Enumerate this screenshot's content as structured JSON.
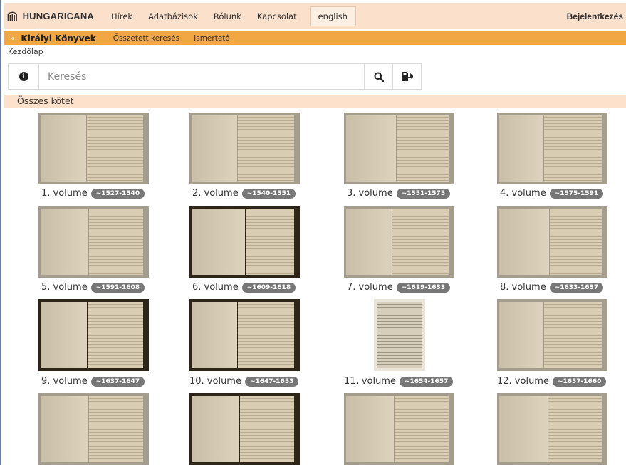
{
  "header": {
    "logo_text": "HUNGARICANA",
    "nav": [
      "Hírek",
      "Adatbázisok",
      "Rólunk",
      "Kapcsolat"
    ],
    "language": "english",
    "login": "Bejelentkezés"
  },
  "subnav": {
    "title": "Királyi Könyvek",
    "links": [
      "Összetett keresés",
      "Ismertető"
    ]
  },
  "breadcrumb": "Kezdőlap",
  "search": {
    "placeholder": "Keresés"
  },
  "section_title": "Összes kötet",
  "volumes": [
    {
      "label": "1. volume",
      "years": "~1527-1540"
    },
    {
      "label": "2. volume",
      "years": "~1540-1551"
    },
    {
      "label": "3. volume",
      "years": "~1551-1575"
    },
    {
      "label": "4. volume",
      "years": "~1575-1591"
    },
    {
      "label": "5. volume",
      "years": "~1591-1608"
    },
    {
      "label": "6. volume",
      "years": "~1609-1618"
    },
    {
      "label": "7. volume",
      "years": "~1619-1633"
    },
    {
      "label": "8. volume",
      "years": "~1633-1637"
    },
    {
      "label": "9. volume",
      "years": "~1637-1647"
    },
    {
      "label": "10. volume",
      "years": "~1647-1653"
    },
    {
      "label": "11. volume",
      "years": "~1654-1657"
    },
    {
      "label": "12. volume",
      "years": "~1657-1660"
    },
    {
      "label": "",
      "years": ""
    },
    {
      "label": "",
      "years": ""
    },
    {
      "label": "",
      "years": ""
    },
    {
      "label": "",
      "years": ""
    }
  ],
  "colors": {
    "topnav": "#fbe1cc",
    "subnav": "#f2a745",
    "badge": "#777777"
  },
  "icons": [
    "logo-icon",
    "info-icon",
    "search-icon",
    "export-icon"
  ]
}
